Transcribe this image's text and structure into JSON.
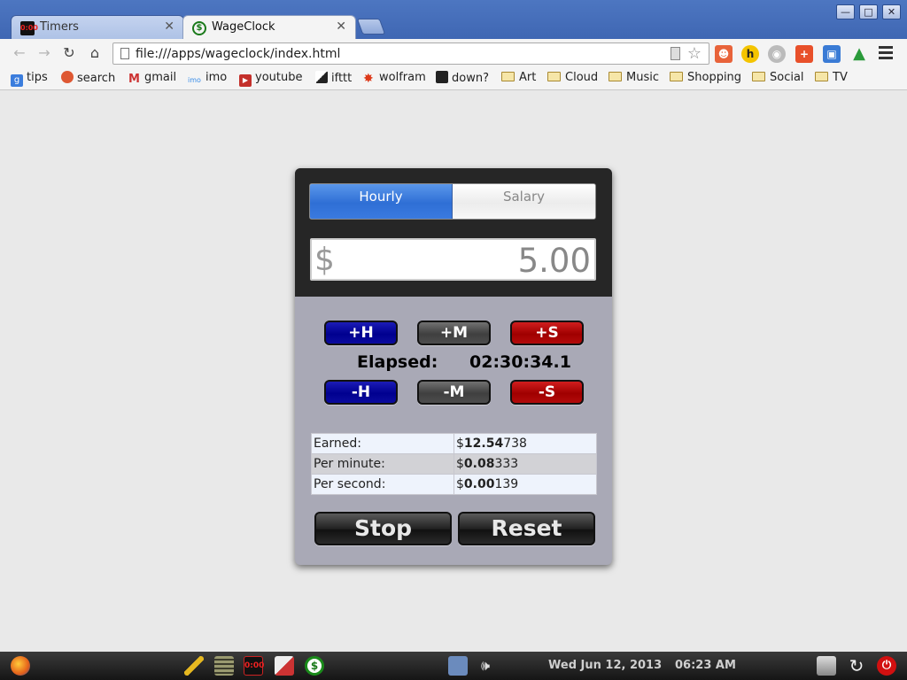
{
  "browser": {
    "tabs": [
      {
        "title": "Timers",
        "icon": "timer-icon"
      },
      {
        "title": "WageClock",
        "icon": "dollar-icon"
      }
    ],
    "address": "file:///apps/wageclock/index.html",
    "window_controls": {
      "minimize": "—",
      "maximize": "□",
      "close": "✕"
    },
    "bookmarks": [
      {
        "label": "tips",
        "icon": "google-icon"
      },
      {
        "label": "search",
        "icon": "duckduckgo-icon"
      },
      {
        "label": "gmail",
        "icon": "gmail-icon"
      },
      {
        "label": "imo",
        "icon": "imo-icon"
      },
      {
        "label": "youtube",
        "icon": "youtube-icon"
      },
      {
        "label": "ifttt",
        "icon": "ifttt-icon"
      },
      {
        "label": "wolfram",
        "icon": "wolfram-icon"
      },
      {
        "label": "down?",
        "icon": "down-icon"
      },
      {
        "label": "Art",
        "icon": "folder-icon"
      },
      {
        "label": "Cloud",
        "icon": "folder-icon"
      },
      {
        "label": "Music",
        "icon": "folder-icon"
      },
      {
        "label": "Shopping",
        "icon": "folder-icon"
      },
      {
        "label": "Social",
        "icon": "folder-icon"
      },
      {
        "label": "TV",
        "icon": "folder-icon"
      }
    ]
  },
  "app": {
    "modes": {
      "hourly": "Hourly",
      "salary": "Salary",
      "selected": "hourly"
    },
    "currency": "$",
    "wage": "5.00",
    "buttons": {
      "add_hour": "+H",
      "add_minute": "+M",
      "add_second": "+S",
      "sub_hour": "-H",
      "sub_minute": "-M",
      "sub_second": "-S",
      "stop": "Stop",
      "reset": "Reset"
    },
    "elapsed_label": "Elapsed:",
    "elapsed_value": "02:30:34.1",
    "stats": [
      {
        "label": "Earned:",
        "prefix": "$",
        "bold": "12.54",
        "rest": "738"
      },
      {
        "label": "Per minute:",
        "prefix": "$",
        "bold": "0.08",
        "rest": "333"
      },
      {
        "label": "Per second:",
        "prefix": "$",
        "bold": "0.00",
        "rest": "139"
      }
    ]
  },
  "taskbar": {
    "date": "Wed Jun 12, 2013",
    "time": "06:23 AM"
  },
  "colors": {
    "hourly_blue": "#2f6fd5",
    "add_hour_blue": "#00008f",
    "second_red": "#a00000",
    "panel_bg": "#a9a9b6"
  }
}
